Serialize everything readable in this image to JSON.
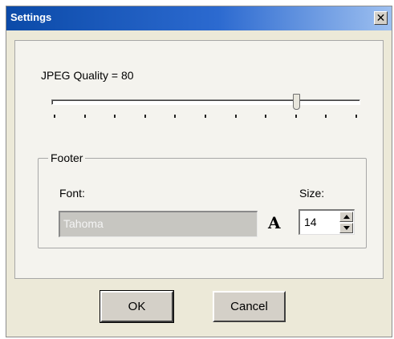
{
  "window": {
    "title": "Settings",
    "close_glyph": "✕",
    "close_icon": "close-icon"
  },
  "quality": {
    "label": "JPEG Quality = 80",
    "value": 80,
    "min": 0,
    "max": 100,
    "tick_count": 11
  },
  "footer": {
    "legend": "Footer",
    "font_label": "Font:",
    "font_value": "Tahoma",
    "font_icon_glyph": "A",
    "font_icon": "font-icon",
    "size_label": "Size:",
    "size_value": "14"
  },
  "buttons": {
    "ok": "OK",
    "cancel": "Cancel"
  },
  "colors": {
    "title_bar_start": "#0b4aa8",
    "title_bar_end": "#9ec0f0",
    "dialog_bg": "#ece9d8",
    "disabled_field": "#c7c6c1"
  }
}
